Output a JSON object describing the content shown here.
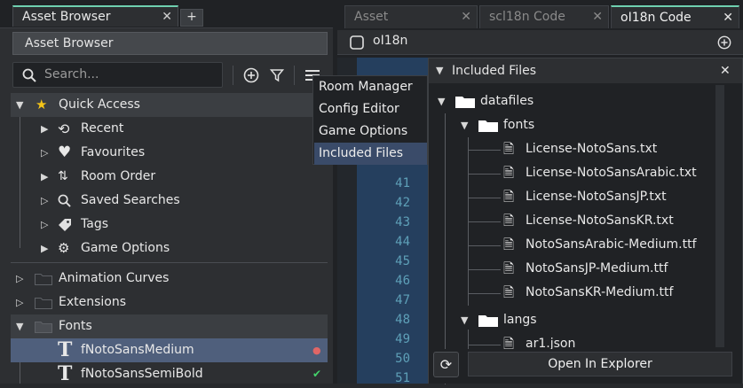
{
  "left_panel": {
    "tabs": [
      {
        "label": "Asset Browser"
      }
    ],
    "title": "Asset Browser",
    "search": {
      "placeholder": "Search..."
    },
    "quick_access": {
      "label": "Quick Access",
      "items": [
        {
          "label": "Recent",
          "icon": "history-icon"
        },
        {
          "label": "Favourites",
          "icon": "heart-icon"
        },
        {
          "label": "Room Order",
          "icon": "room-order-icon"
        },
        {
          "label": "Saved Searches",
          "icon": "search-icon"
        },
        {
          "label": "Tags",
          "icon": "tag-icon"
        },
        {
          "label": "Game Options",
          "icon": "gear-icon"
        }
      ]
    },
    "groups": [
      {
        "label": "Animation Curves"
      },
      {
        "label": "Extensions"
      },
      {
        "label": "Fonts"
      }
    ],
    "fonts": [
      {
        "label": "fNotoSansMedium",
        "status": "warning"
      },
      {
        "label": "fNotoSansSemiBold",
        "status": "ok"
      }
    ]
  },
  "menu": {
    "items": [
      {
        "label": "Room Manager"
      },
      {
        "label": "Config Editor"
      },
      {
        "label": "Game Options"
      },
      {
        "label": "Included Files"
      }
    ]
  },
  "right_panel": {
    "tabs": [
      {
        "label": "Asset"
      },
      {
        "label": "scl18n Code"
      },
      {
        "label": "oI18n Code"
      }
    ],
    "title": "oI18n",
    "line_numbers": [
      "41",
      "42",
      "43",
      "44",
      "45",
      "46",
      "47",
      "48",
      "49",
      "50",
      "51"
    ]
  },
  "included_files": {
    "title": "Included Files",
    "tree": [
      {
        "label": "datafiles",
        "type": "folder"
      },
      {
        "label": "fonts",
        "type": "folder"
      },
      {
        "label": "License-NotoSans.txt",
        "type": "file"
      },
      {
        "label": "License-NotoSansArabic.txt",
        "type": "file"
      },
      {
        "label": "License-NotoSansJP.txt",
        "type": "file"
      },
      {
        "label": "License-NotoSansKR.txt",
        "type": "file"
      },
      {
        "label": "NotoSansArabic-Medium.ttf",
        "type": "file"
      },
      {
        "label": "NotoSansJP-Medium.ttf",
        "type": "file"
      },
      {
        "label": "NotoSansKR-Medium.ttf",
        "type": "file"
      },
      {
        "label": "langs",
        "type": "folder"
      },
      {
        "label": "ar1.json",
        "type": "file"
      }
    ],
    "open_button": "Open In Explorer"
  },
  "colors": {
    "accent": "#6fd0b0",
    "selection": "#4f5f7c",
    "code_bg": "#1e3a5a"
  }
}
